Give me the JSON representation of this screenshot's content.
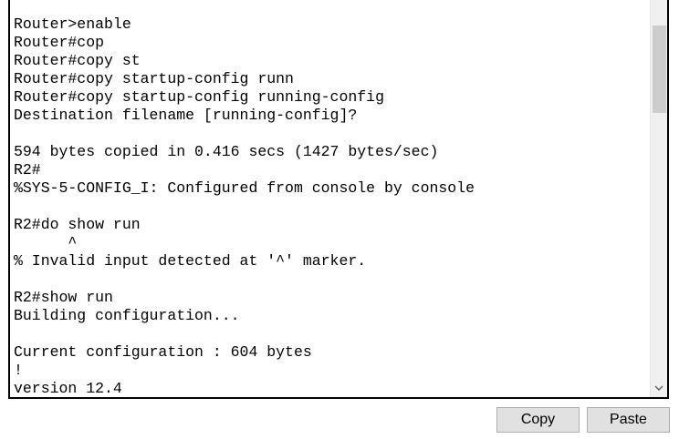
{
  "terminal": {
    "lines": [
      "Router>enable",
      "Router#cop",
      "Router#copy st",
      "Router#copy startup-config runn",
      "Router#copy startup-config running-config",
      "Destination filename [running-config]?",
      "",
      "594 bytes copied in 0.416 secs (1427 bytes/sec)",
      "R2#",
      "%SYS-5-CONFIG_I: Configured from console by console",
      "",
      "R2#do show run",
      "      ^",
      "% Invalid input detected at '^' marker.",
      "",
      "R2#show run",
      "Building configuration...",
      "",
      "Current configuration : 604 bytes",
      "!",
      "version 12.4"
    ]
  },
  "scrollbar": {
    "down_icon": "chevron-down-icon"
  },
  "buttons": {
    "copy_label": "Copy",
    "paste_label": "Paste"
  }
}
